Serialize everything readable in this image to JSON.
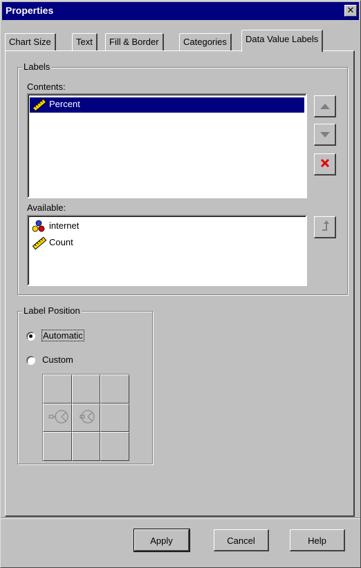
{
  "window": {
    "title": "Properties"
  },
  "tabs": [
    {
      "label": "Chart Size",
      "active": false
    },
    {
      "label": "Text",
      "active": false
    },
    {
      "label": "Fill & Border",
      "active": false
    },
    {
      "label": "Categories",
      "active": false
    },
    {
      "label": "Data Value Labels",
      "active": true
    }
  ],
  "labels_group": {
    "title": "Labels",
    "contents_label": "Contents:",
    "contents": [
      {
        "label": "Percent",
        "icon": "ruler-icon",
        "selected": true
      }
    ],
    "available_label": "Available:",
    "available": [
      {
        "label": "internet",
        "icon": "nominal-variable-icon"
      },
      {
        "label": "Count",
        "icon": "ruler-icon"
      }
    ]
  },
  "label_position": {
    "title": "Label Position",
    "options": [
      {
        "label": "Automatic",
        "checked": true
      },
      {
        "label": "Custom",
        "checked": false
      }
    ]
  },
  "buttons": {
    "apply": "Apply",
    "cancel": "Cancel",
    "help": "Help"
  },
  "colors": {
    "titlebar": "#000080",
    "selection": "#000080",
    "delete_red": "#e00000"
  }
}
